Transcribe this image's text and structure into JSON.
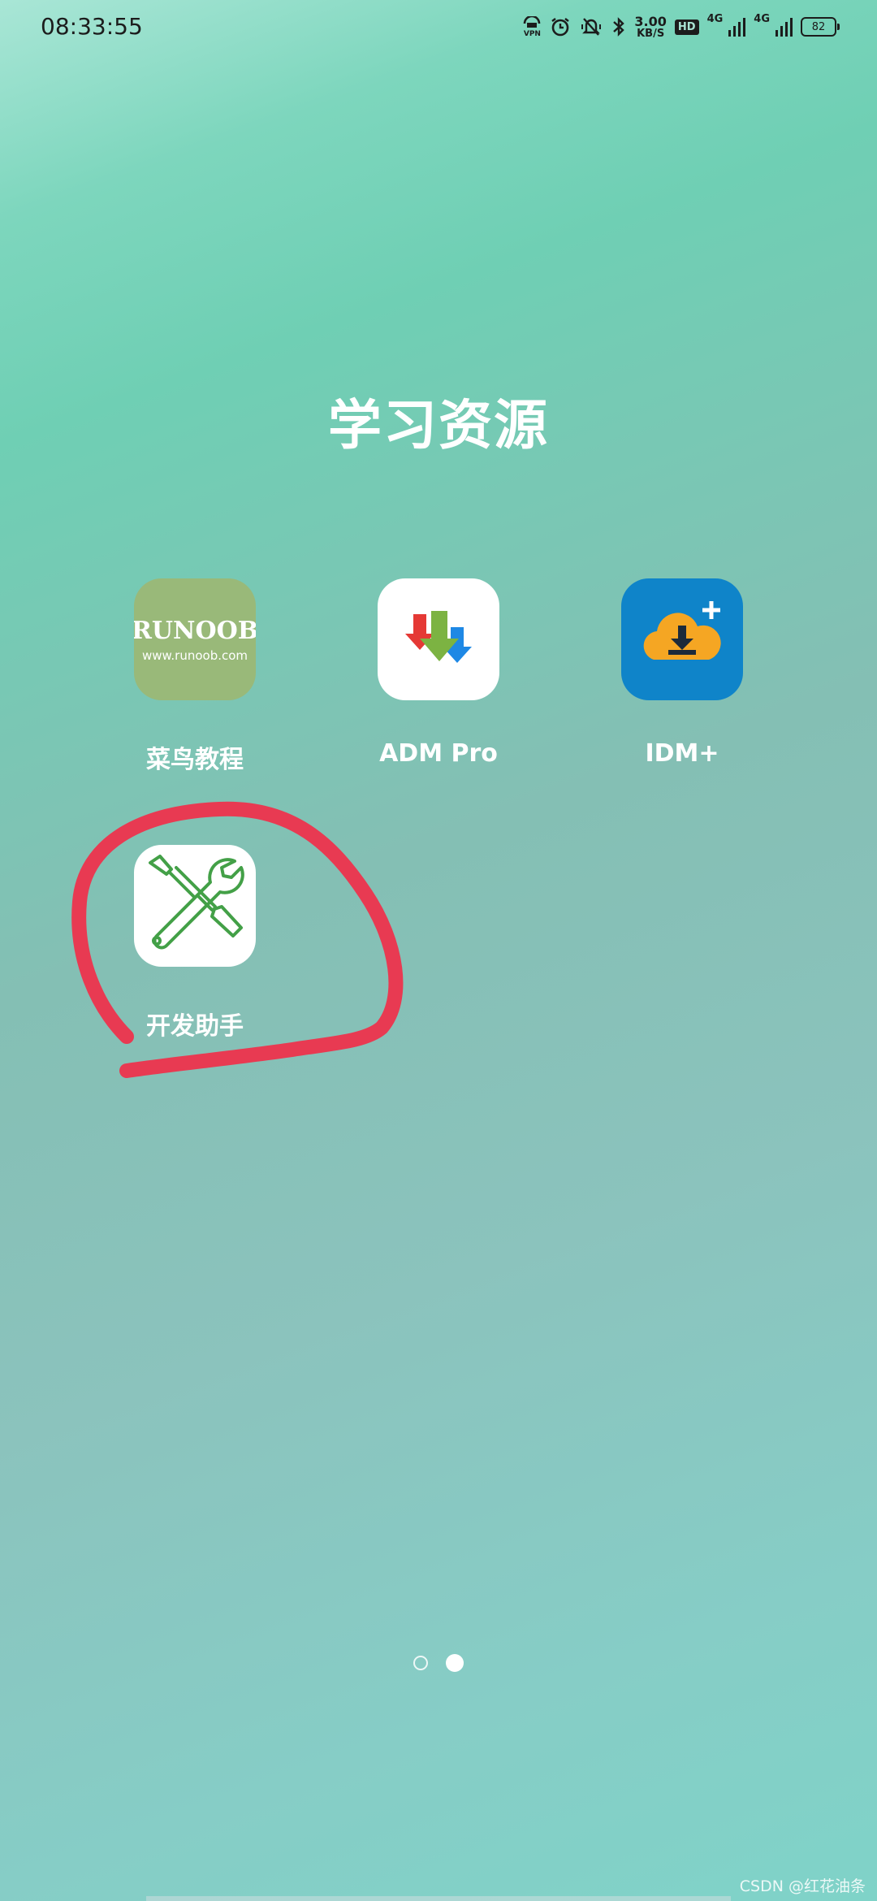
{
  "status_bar": {
    "time": "08:33:55",
    "vpn_label": "VPN",
    "speed_value": "3.00",
    "speed_unit": "KB/S",
    "hd_label": "HD",
    "signal1_label": "4G",
    "signal2_label": "4G",
    "battery_level": "82"
  },
  "folder": {
    "title": "学习资源",
    "apps": [
      {
        "label": "菜鸟教程",
        "icon_title": "RUNOOB",
        "icon_subtitle": "www.runoob.com"
      },
      {
        "label": "ADM Pro"
      },
      {
        "label": "IDM+"
      },
      {
        "label": "开发助手"
      }
    ]
  },
  "pager": {
    "pages": 2,
    "current": 2
  },
  "watermark": "CSDN @红花油条",
  "colors": {
    "annotation": "#e83a52",
    "runoob_bg": "#99b979",
    "idm_bg": "#0f84c9"
  }
}
